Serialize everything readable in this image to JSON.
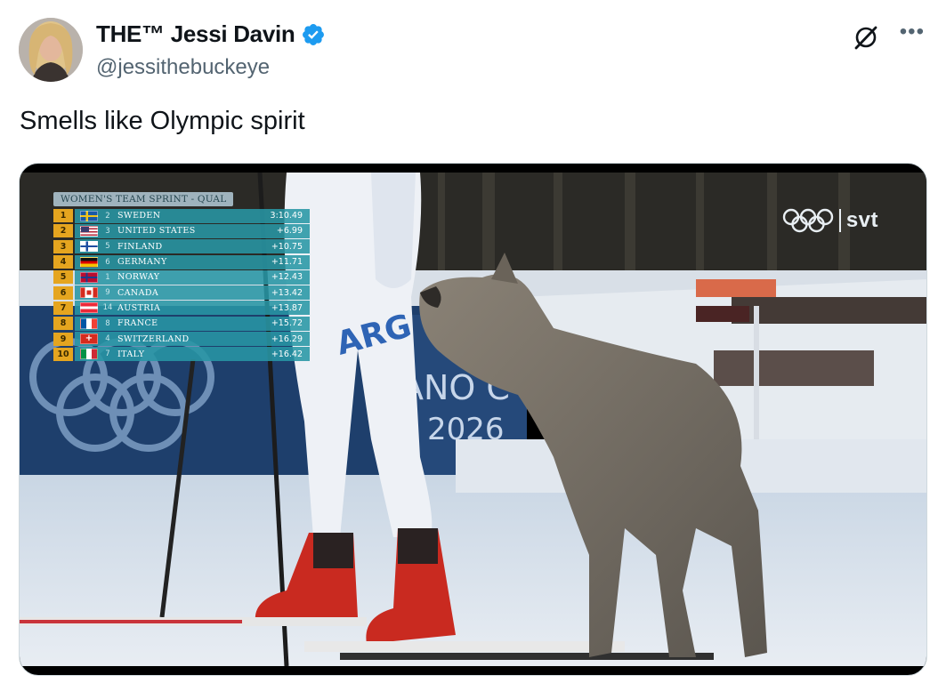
{
  "tweet": {
    "display_name": "THE™ Jessi Davin",
    "handle": "@jessithebuckeye",
    "text": "Smells like Olympic spirit",
    "icons": {
      "verified": "verified-badge-icon",
      "grok": "grok-icon",
      "more": "more-options-icon"
    },
    "colors": {
      "verified": "#1d9bf0",
      "handle": "#536471"
    }
  },
  "video": {
    "scoreboard": {
      "title": "WOMEN'S TEAM SPRINT - QUAL",
      "rows": [
        {
          "rank": "1",
          "bib": "2",
          "country": "SWEDEN",
          "time": "3:10.49",
          "flag": "sweden"
        },
        {
          "rank": "2",
          "bib": "3",
          "country": "UNITED STATES",
          "time": "+6.99",
          "flag": "usa"
        },
        {
          "rank": "3",
          "bib": "5",
          "country": "FINLAND",
          "time": "+10.75",
          "flag": "finland"
        },
        {
          "rank": "4",
          "bib": "6",
          "country": "GERMANY",
          "time": "+11.71",
          "flag": "germany"
        },
        {
          "rank": "5",
          "bib": "1",
          "country": "NORWAY",
          "time": "+12.43",
          "flag": "norway"
        },
        {
          "rank": "6",
          "bib": "9",
          "country": "CANADA",
          "time": "+13.42",
          "flag": "canada"
        },
        {
          "rank": "7",
          "bib": "14",
          "country": "AUSTRIA",
          "time": "+13.87",
          "flag": "austria"
        },
        {
          "rank": "8",
          "bib": "8",
          "country": "FRANCE",
          "time": "+15.72",
          "flag": "france"
        },
        {
          "rank": "9",
          "bib": "4",
          "country": "SWITZERLAND",
          "time": "+16.29",
          "flag": "switzerland"
        },
        {
          "rank": "10",
          "bib": "7",
          "country": "ITALY",
          "time": "+16.42",
          "flag": "italy"
        }
      ]
    },
    "broadcaster": "svt",
    "banner_text": "ANO C",
    "banner_year": "2026",
    "bib_text": "ARG"
  }
}
